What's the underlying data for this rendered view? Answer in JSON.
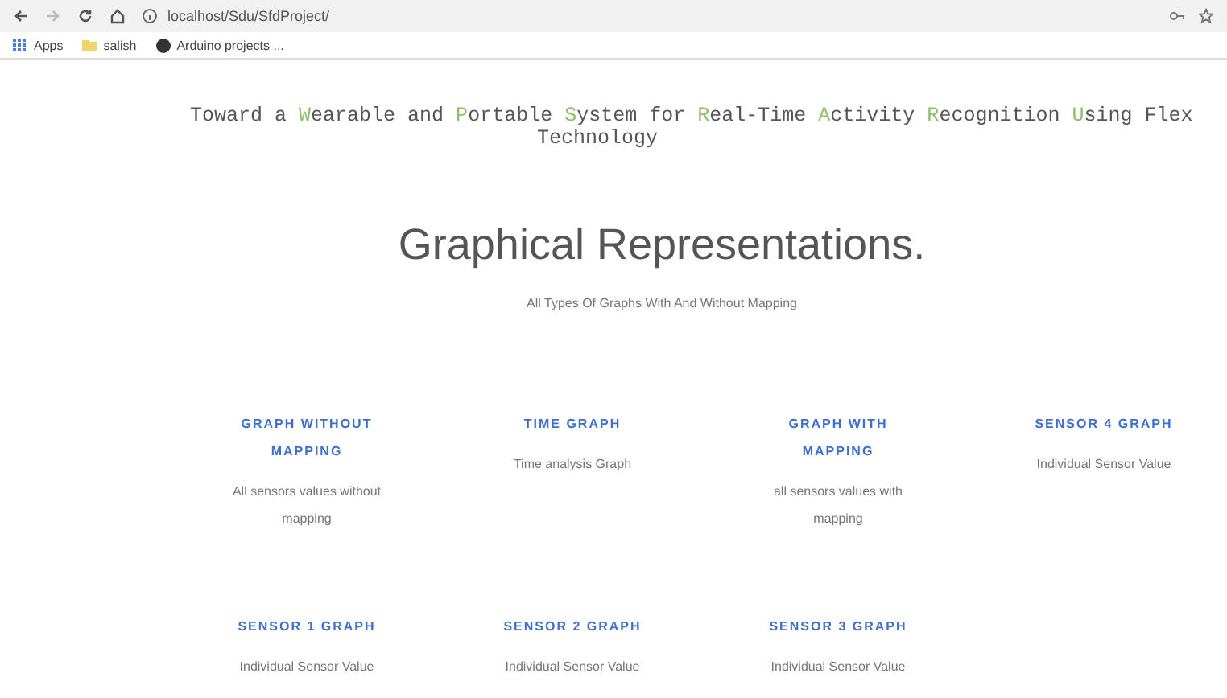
{
  "browser": {
    "url": "localhost/Sdu/SfdProject/",
    "bookmarks": [
      {
        "kind": "apps",
        "label": "Apps"
      },
      {
        "kind": "folder",
        "label": "salish"
      },
      {
        "kind": "site",
        "label": "Arduino projects ..."
      }
    ]
  },
  "title": [
    {
      "text": "Toward a ",
      "accent": false
    },
    {
      "text": "W",
      "accent": true
    },
    {
      "text": "earable and ",
      "accent": false
    },
    {
      "text": "P",
      "accent": true
    },
    {
      "text": "ortable ",
      "accent": false
    },
    {
      "text": "S",
      "accent": true
    },
    {
      "text": "ystem for ",
      "accent": false
    },
    {
      "text": "R",
      "accent": true
    },
    {
      "text": "eal-Time ",
      "accent": false
    },
    {
      "text": "A",
      "accent": true
    },
    {
      "text": "ctivity ",
      "accent": false
    },
    {
      "text": "R",
      "accent": true
    },
    {
      "text": "ecognition ",
      "accent": false
    },
    {
      "text": "U",
      "accent": true
    },
    {
      "text": "sing ",
      "accent": false
    },
    {
      "text": "Flex",
      "accent": false
    }
  ],
  "title_line2": "Technology",
  "heading": "Graphical Representations.",
  "subheading": "All Types Of Graphs With And Without Mapping",
  "cards": [
    {
      "title": "GRAPH WITHOUT MAPPING",
      "text": "All sensors values without mapping"
    },
    {
      "title": "TIME GRAPH",
      "text": "Time analysis Graph"
    },
    {
      "title": "GRAPH WITH MAPPING",
      "text": "all sensors values with mapping"
    },
    {
      "title": "SENSOR 4 GRAPH",
      "text": "Individual Sensor Value"
    },
    {
      "title": "SENSOR 1 GRAPH",
      "text": "Individual Sensor Value"
    },
    {
      "title": "SENSOR 2 GRAPH",
      "text": "Individual Sensor Value"
    },
    {
      "title": "SENSOR 3 GRAPH",
      "text": "Individual Sensor Value"
    }
  ]
}
